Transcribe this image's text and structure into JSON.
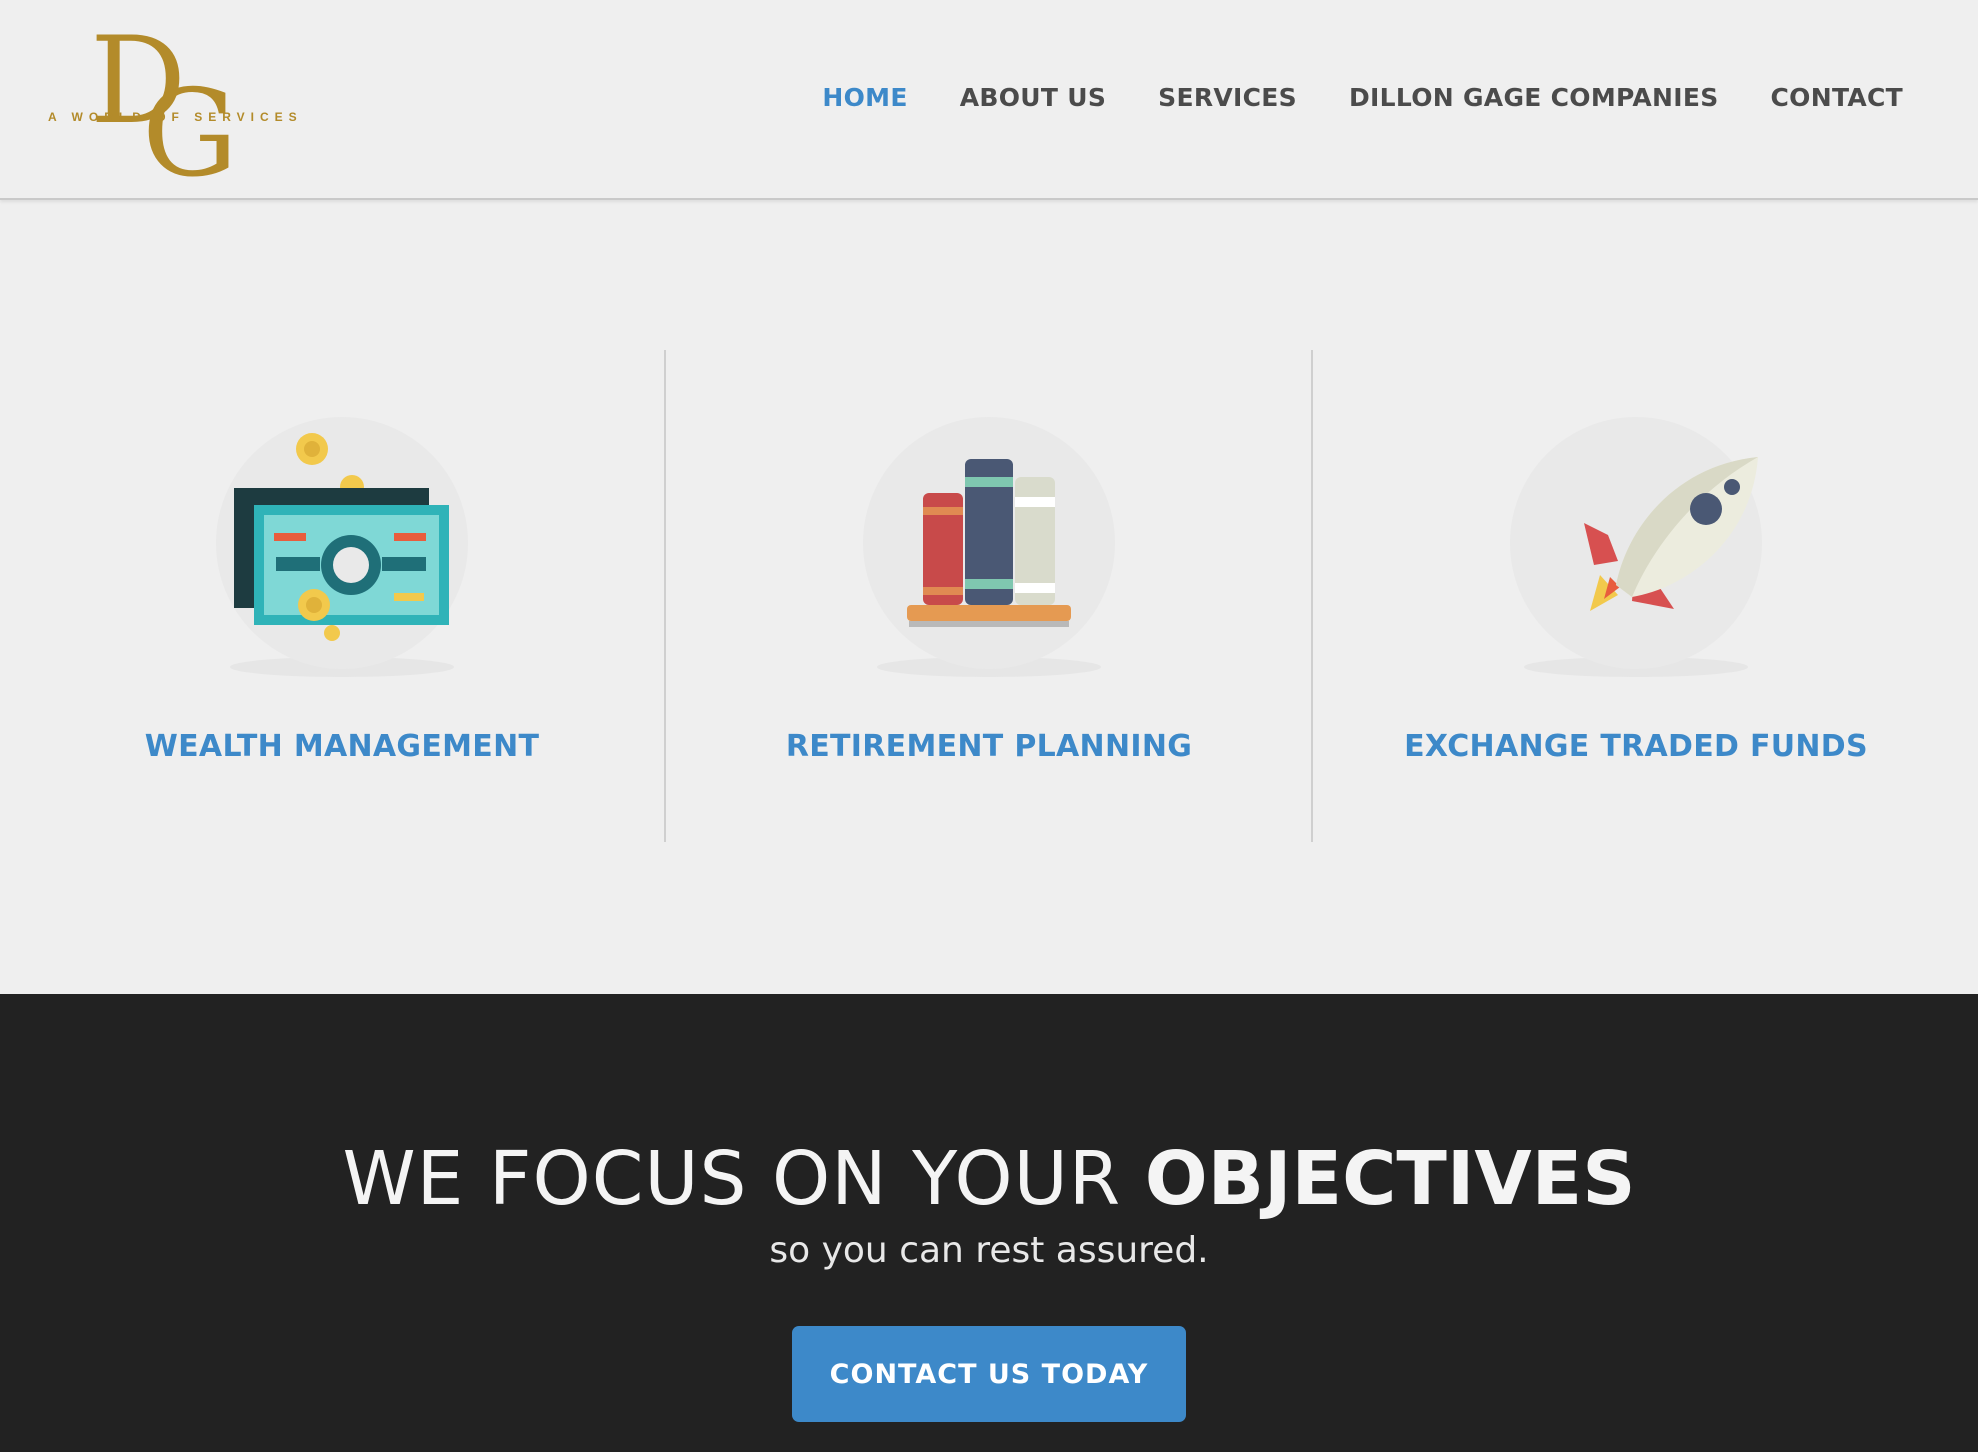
{
  "brand": {
    "monogram": "DG",
    "tagline": "A WORLD OF SERVICES",
    "color": "#b38b2a"
  },
  "nav": {
    "items": [
      "HOME",
      "ABOUT US",
      "SERVICES",
      "DILLON GAGE COMPANIES",
      "CONTACT"
    ],
    "active_index": 0
  },
  "services": [
    {
      "title": "WEALTH MANAGEMENT",
      "icon": "money-bills-icon"
    },
    {
      "title": "RETIREMENT PLANNING",
      "icon": "books-icon"
    },
    {
      "title": "EXCHANGE TRADED FUNDS",
      "icon": "rocket-icon"
    }
  ],
  "band": {
    "headline_light": "WE FOCUS ON YOUR",
    "headline_bold": "OBJECTIVES",
    "subline": "so you can rest assured.",
    "cta_label": "CONTACT US TODAY"
  },
  "colors": {
    "accent": "#3d89c9",
    "background": "#efefef",
    "band": "#222222",
    "nav_text": "#4b4b4b"
  }
}
